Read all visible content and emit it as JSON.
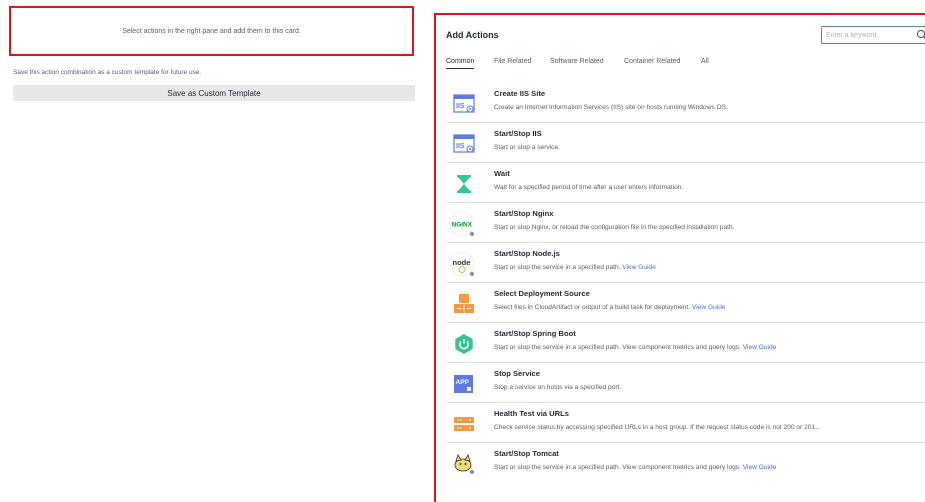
{
  "left": {
    "card_text": "Select actions in the right pane and add them to this card.",
    "template_hint": "Save this action combination as a custom template for future use.",
    "save_button": "Save as Custom Template"
  },
  "right": {
    "title": "Add Actions",
    "search_placeholder": "Enter a keyword.",
    "tabs": [
      "Common",
      "File Related",
      "Software Related",
      "Container Related",
      "All"
    ],
    "active_tab": "Common",
    "actions": [
      {
        "title": "Create IIS Site",
        "desc": "Create an Internet Information Services (IIS) site on hosts running Windows OS.",
        "link": "",
        "icon": "iis-icon"
      },
      {
        "title": "Start/Stop IIS",
        "desc": "Start or stop a service.",
        "link": "",
        "icon": "iis-icon"
      },
      {
        "title": "Wait",
        "desc": "Wait for a specified period of time after a user enters information.",
        "link": "",
        "icon": "hourglass-icon"
      },
      {
        "title": "Start/Stop Nginx",
        "desc": "Start or stop Nginx, or reload the configuration file in the specified installation path.",
        "link": "",
        "icon": "nginx-icon"
      },
      {
        "title": "Start/Stop Node.js",
        "desc": "Start or stop the service in a specified path.",
        "link": "View Guide",
        "icon": "nodejs-icon"
      },
      {
        "title": "Select Deployment Source",
        "desc": "Select files in CloudArtifact or output of a build task for deployment.",
        "link": "View Guide",
        "icon": "deployment-source-icon"
      },
      {
        "title": "Start/Stop Spring Boot",
        "desc": "Start or stop the service in a specified path. View component metrics and query logs.",
        "link": "View Guide",
        "icon": "spring-boot-icon"
      },
      {
        "title": "Stop Service",
        "desc": "Stop a service on hosts via a specified port.",
        "link": "",
        "icon": "app-icon"
      },
      {
        "title": "Health Test via URLs",
        "desc": "Check service status by accessing specified URLs in a host group. If the request status code is not 200 or 201...",
        "link": "",
        "icon": "health-test-icon"
      },
      {
        "title": "Start/Stop Tomcat",
        "desc": "Start or stop the service in a specified path. View component metrics and query logs.",
        "link": "View Guide",
        "icon": "tomcat-icon"
      }
    ]
  },
  "colors": {
    "highlight_border": "#e0141e",
    "link": "#526ecc",
    "search_border": "#5e7ce0"
  }
}
